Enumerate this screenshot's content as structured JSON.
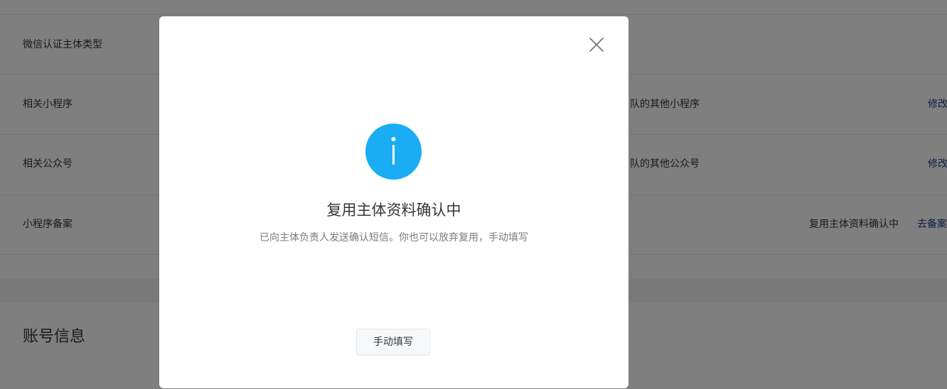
{
  "background": {
    "rows": [
      {
        "label": "微信认证主体类型",
        "desc": "",
        "status": "",
        "action": ""
      },
      {
        "label": "相关小程序",
        "desc": "队的其他小程序",
        "status": "",
        "action": "修改"
      },
      {
        "label": "相关公众号",
        "desc": "队的其他公众号",
        "status": "",
        "action": "修改"
      },
      {
        "label": "小程序备案",
        "desc": "",
        "status": "复用主体资料确认中",
        "action": "去备案"
      }
    ],
    "section_title": "账号信息"
  },
  "dialog": {
    "close_icon": "close-icon",
    "status_icon": "info-icon",
    "accent_color": "#1aadf3",
    "title": "复用主体资料确认中",
    "description": "已向主体负责人发送确认短信。你也可以放弃复用，手动填写",
    "manual_button_label": "手动填写"
  }
}
